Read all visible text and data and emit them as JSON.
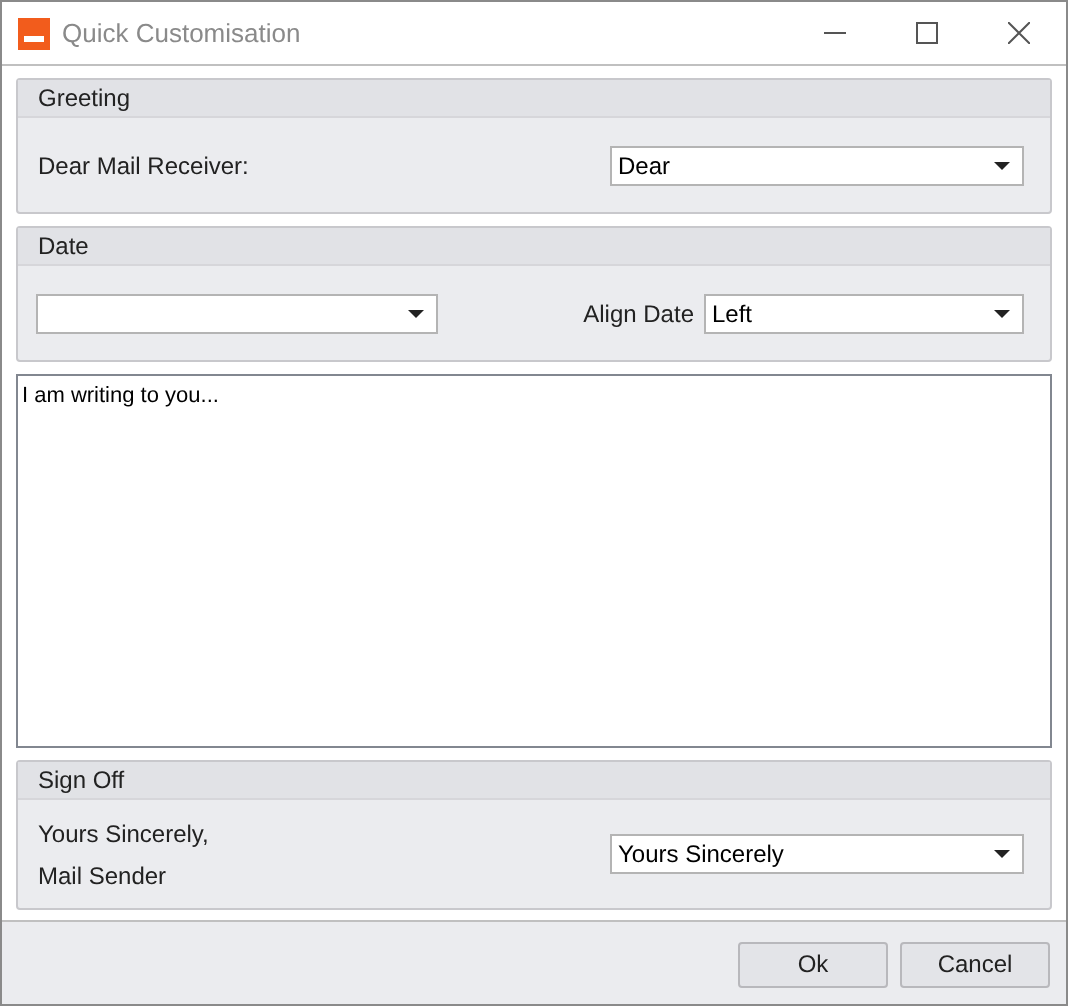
{
  "window": {
    "title": "Quick Customisation"
  },
  "greeting": {
    "title": "Greeting",
    "label": "Dear Mail Receiver:",
    "value": "Dear"
  },
  "date": {
    "title": "Date",
    "align_label": "Align Date",
    "align_value": "Left"
  },
  "body": {
    "value": "I am writing to you..."
  },
  "sign_off": {
    "title": "Sign Off",
    "label_lines": [
      "Yours Sincerely,",
      "Mail Sender"
    ],
    "value": "Yours Sincerely"
  },
  "buttons": [
    "Ok",
    "Cancel"
  ]
}
